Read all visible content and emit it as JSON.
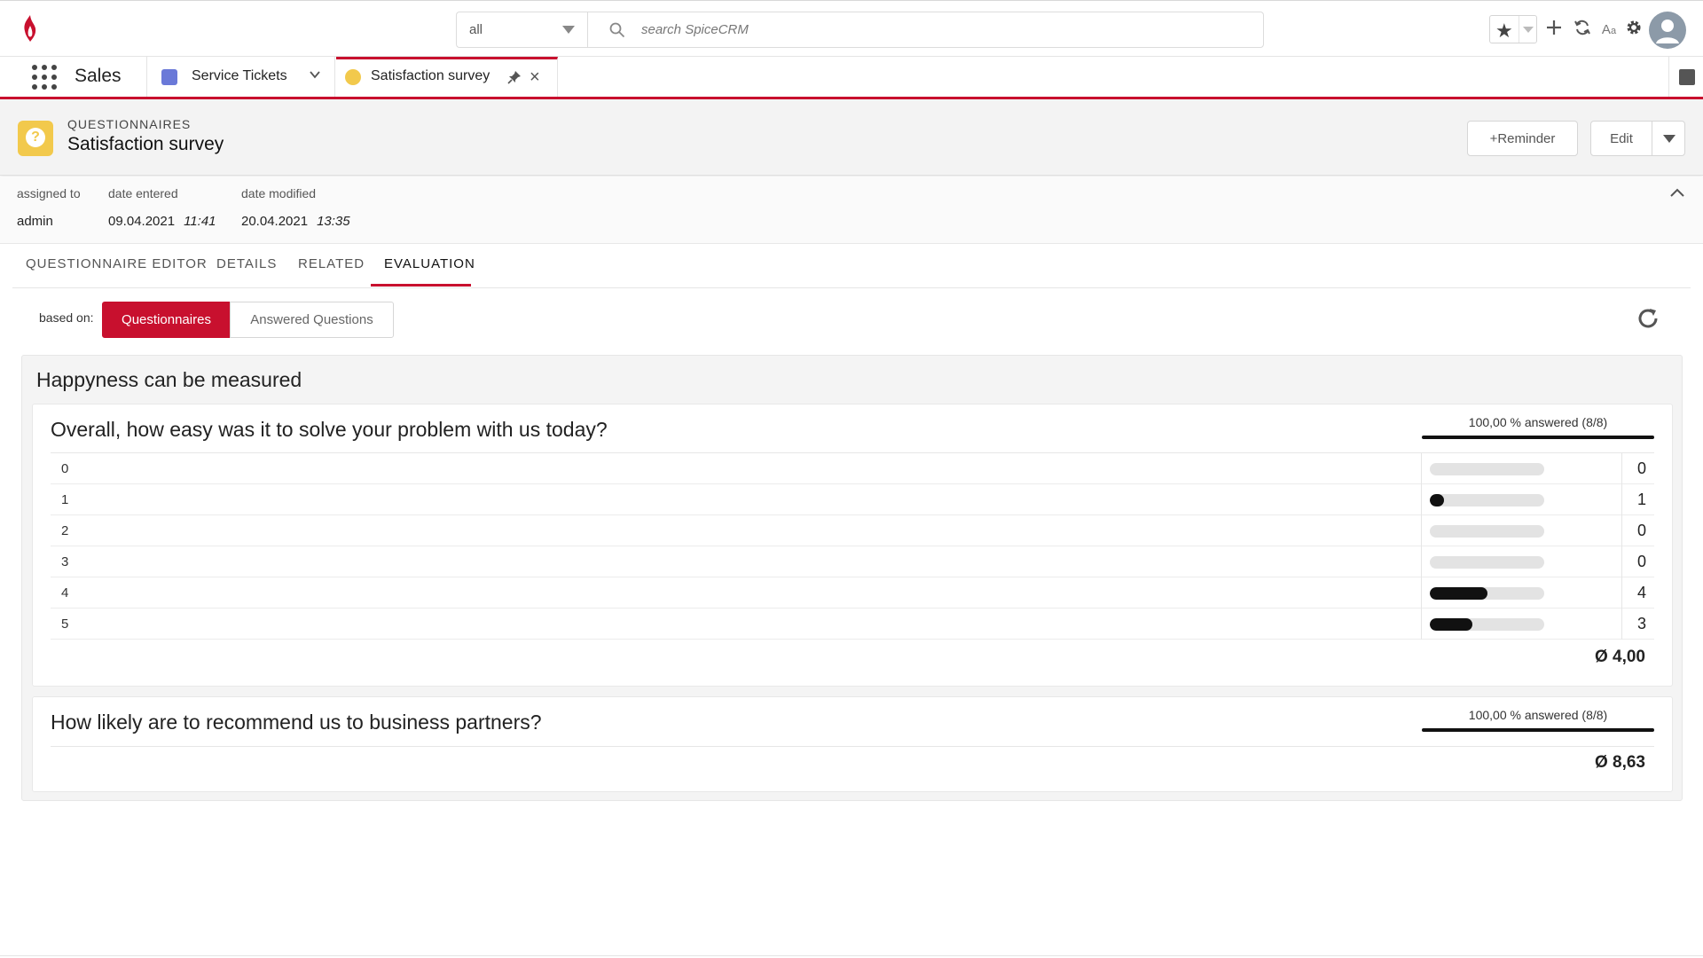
{
  "topbar": {
    "scope_value": "all",
    "search_placeholder": "search SpiceCRM"
  },
  "nav": {
    "app_name": "Sales",
    "tabs": [
      {
        "label": "Service Tickets"
      },
      {
        "label": "Satisfaction survey"
      }
    ]
  },
  "header": {
    "module": "QUESTIONNAIRES",
    "title": "Satisfaction survey",
    "reminder_label": "+Reminder",
    "edit_label": "Edit"
  },
  "fields": {
    "assigned_to": {
      "label": "assigned to",
      "value": "admin"
    },
    "date_entered": {
      "label": "date entered",
      "date": "09.04.2021",
      "time": "11:41"
    },
    "date_modified": {
      "label": "date modified",
      "date": "20.04.2021",
      "time": "13:35"
    }
  },
  "record_tabs": [
    "QUESTIONNAIRE EDITOR",
    "DETAILS",
    "RELATED",
    "EVALUATION"
  ],
  "evaluation": {
    "based_on_label": "based on:",
    "options": [
      "Questionnaires",
      "Answered Questions"
    ],
    "selected": "Questionnaires",
    "section_title": "Happyness can be measured",
    "questions": [
      {
        "text": "Overall, how easy was it to solve your problem with us today?",
        "answered": "100,00 % answered (8/8)",
        "answers": [
          {
            "option": "0",
            "count": "0",
            "share": 0
          },
          {
            "option": "1",
            "count": "1",
            "share": 0.125
          },
          {
            "option": "2",
            "count": "0",
            "share": 0
          },
          {
            "option": "3",
            "count": "0",
            "share": 0
          },
          {
            "option": "4",
            "count": "4",
            "share": 0.5
          },
          {
            "option": "5",
            "count": "3",
            "share": 0.375
          }
        ],
        "average": "Ø  4,00"
      },
      {
        "text": "How likely are to recommend us to business partners?",
        "answered": "100,00 % answered (8/8)",
        "average": "Ø  8,63"
      }
    ]
  },
  "colors": {
    "brand_red": "#c8102e",
    "bar_fill": "#111111",
    "bar_track": "#e3e3e3",
    "module_icon": "#f2c94c"
  }
}
